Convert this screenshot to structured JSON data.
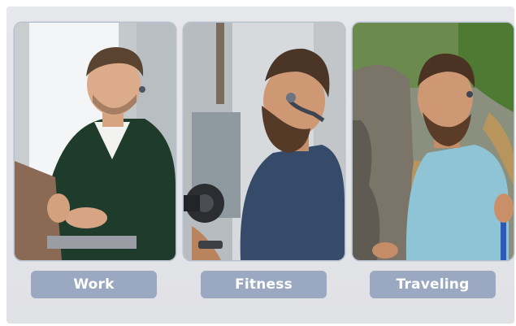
{
  "panels": [
    {
      "label": "Work",
      "icon": "person-at-laptop-photo"
    },
    {
      "label": "Fitness",
      "icon": "person-with-dumbbell-photo"
    },
    {
      "label": "Traveling",
      "icon": "hiker-with-backpack-photo"
    }
  ],
  "colors": {
    "background": "#e3e4e8",
    "label_bg": "#9aa9c1",
    "label_text": "#ffffff",
    "card_border": "#b7c0cf"
  }
}
